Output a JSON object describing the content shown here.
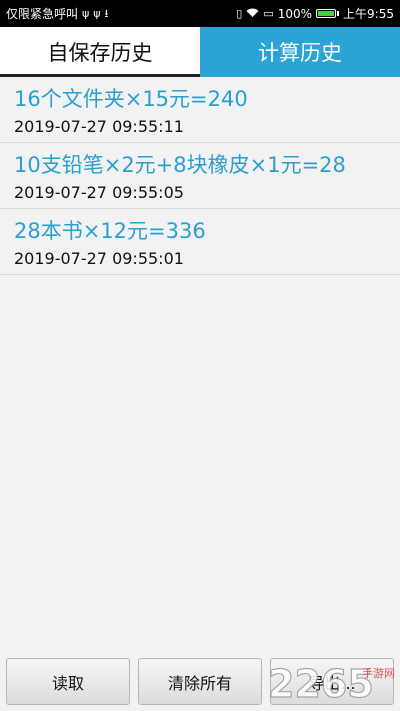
{
  "status_bar": {
    "left_text": "仅限紧急呼叫",
    "icons_left": [
      "usb-icon",
      "usb-icon",
      "download-icon"
    ],
    "battery_percent": "100%",
    "battery_level": 1.0,
    "time": "上午9:55",
    "icons_right": [
      "vibrate-icon",
      "wifi-icon",
      "sim-icon",
      "battery-icon"
    ]
  },
  "tabs": [
    {
      "label": "自保存历史",
      "active": false
    },
    {
      "label": "计算历史",
      "active": true
    }
  ],
  "history": [
    {
      "expression": "16个文件夹×15元=240",
      "time": "2019-07-27 09:55:11"
    },
    {
      "expression": "10支铅笔×2元+8块橡皮×1元=28",
      "time": "2019-07-27 09:55:05"
    },
    {
      "expression": "28本书×12元=336",
      "time": "2019-07-27 09:55:01"
    }
  ],
  "buttons": {
    "read": "读取",
    "clear_all": "清除所有",
    "export": "导出..."
  },
  "watermark": {
    "brand": "2265",
    "site": "手游网"
  },
  "colors": {
    "accent": "#2ba4d5",
    "item_text": "#2b9fd0",
    "background": "#f2f2f2"
  }
}
